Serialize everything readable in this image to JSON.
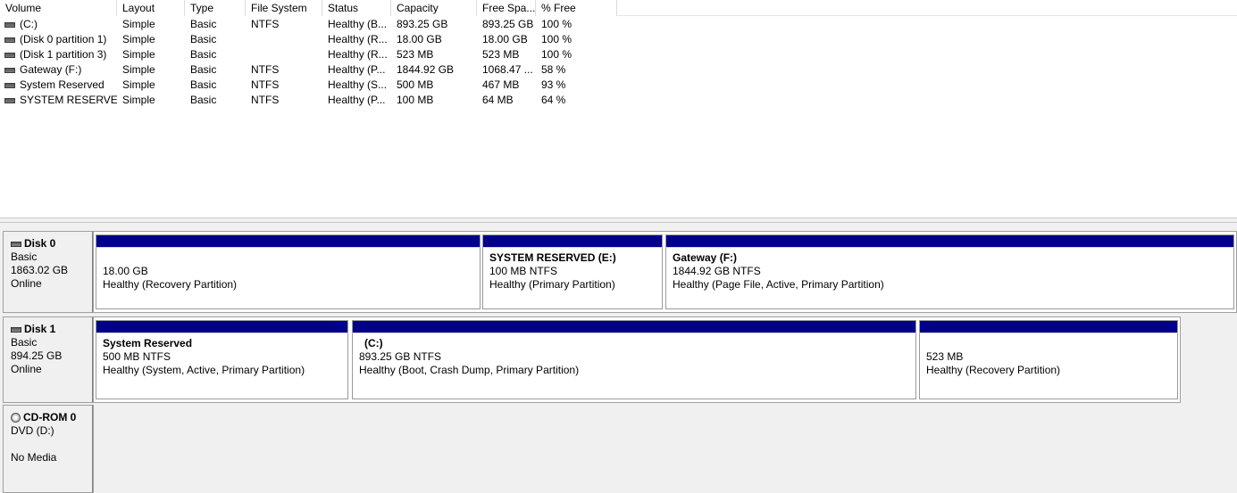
{
  "volume_list": {
    "columns": [
      "Volume",
      "Layout",
      "Type",
      "File System",
      "Status",
      "Capacity",
      "Free Spa...",
      "% Free"
    ],
    "rows": [
      {
        "volume": "(C:)",
        "layout": "Simple",
        "type": "Basic",
        "fs": "NTFS",
        "status": "Healthy (B...",
        "capacity": "893.25 GB",
        "free": "893.25 GB",
        "pct": "100 %"
      },
      {
        "volume": "(Disk 0 partition 1)",
        "layout": "Simple",
        "type": "Basic",
        "fs": "",
        "status": "Healthy (R...",
        "capacity": "18.00 GB",
        "free": "18.00 GB",
        "pct": "100 %"
      },
      {
        "volume": "(Disk 1 partition 3)",
        "layout": "Simple",
        "type": "Basic",
        "fs": "",
        "status": "Healthy (R...",
        "capacity": "523 MB",
        "free": "523 MB",
        "pct": "100 %"
      },
      {
        "volume": "Gateway (F:)",
        "layout": "Simple",
        "type": "Basic",
        "fs": "NTFS",
        "status": "Healthy (P...",
        "capacity": "1844.92 GB",
        "free": "1068.47 ...",
        "pct": "58 %"
      },
      {
        "volume": "System Reserved",
        "layout": "Simple",
        "type": "Basic",
        "fs": "NTFS",
        "status": "Healthy (S...",
        "capacity": "500 MB",
        "free": "467 MB",
        "pct": "93 %"
      },
      {
        "volume": "SYSTEM RESERVED...",
        "layout": "Simple",
        "type": "Basic",
        "fs": "NTFS",
        "status": "Healthy (P...",
        "capacity": "100 MB",
        "free": "64 MB",
        "pct": "64 %"
      }
    ]
  },
  "disks": [
    {
      "name": "Disk 0",
      "kind": "Basic",
      "size": "1863.02 GB",
      "state": "Online",
      "partitions": [
        {
          "title": "",
          "size_fs": "18.00 GB",
          "status": "Healthy (Recovery Partition)"
        },
        {
          "title": "SYSTEM RESERVED  (E:)",
          "size_fs": "100 MB NTFS",
          "status": "Healthy (Primary Partition)"
        },
        {
          "title": "Gateway  (F:)",
          "size_fs": "1844.92 GB NTFS",
          "status": "Healthy (Page File, Active, Primary Partition)"
        }
      ]
    },
    {
      "name": "Disk 1",
      "kind": "Basic",
      "size": "894.25 GB",
      "state": "Online",
      "partitions": [
        {
          "title": "System Reserved",
          "size_fs": "500 MB NTFS",
          "status": "Healthy (System, Active, Primary Partition)"
        },
        {
          "title": "(C:)",
          "size_fs": "893.25 GB NTFS",
          "status": "Healthy (Boot, Crash Dump, Primary Partition)"
        },
        {
          "title": "",
          "size_fs": "523 MB",
          "status": "Healthy (Recovery Partition)"
        }
      ]
    }
  ],
  "cdrom": {
    "name": "CD-ROM 0",
    "drive": "DVD (D:)",
    "media": "No Media"
  },
  "colors": {
    "partition_bar": "#00008b",
    "pane_bg": "#f0f0f0"
  }
}
